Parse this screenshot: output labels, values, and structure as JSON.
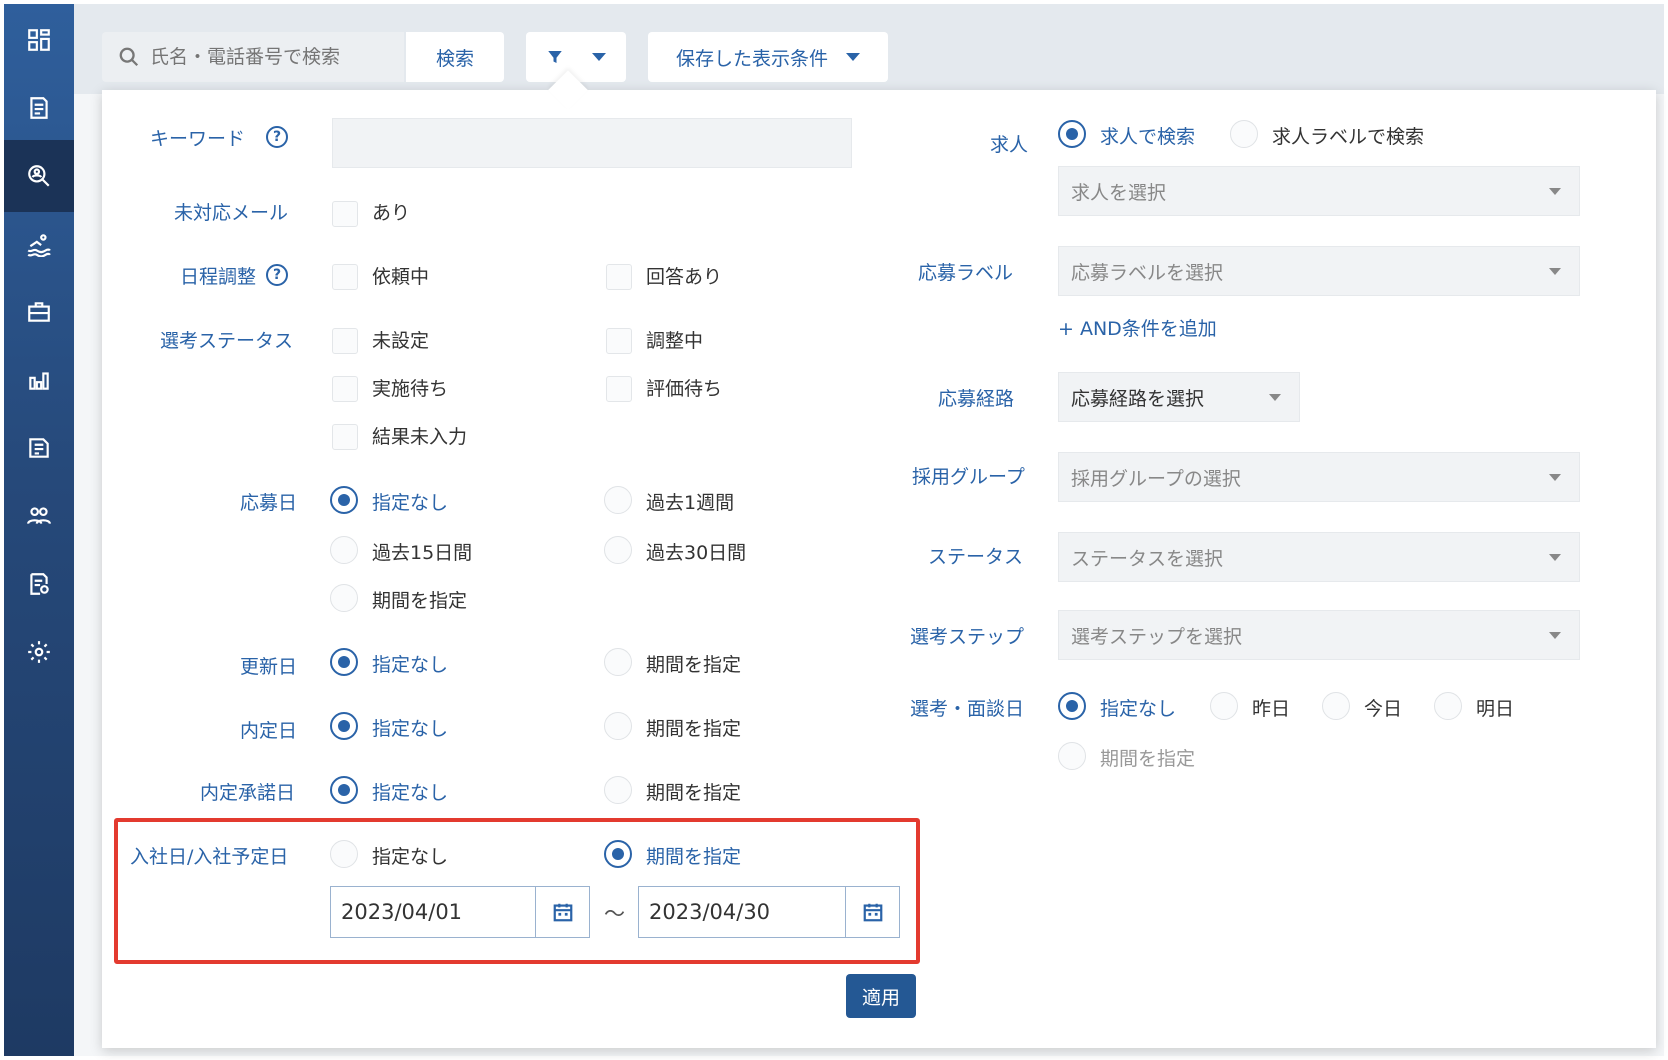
{
  "topbar": {
    "search_placeholder": "氏名・電話番号で検索",
    "search_button": "検索",
    "saved_conditions": "保存した表示条件"
  },
  "sidebar": {
    "items": [
      {
        "icon": "dashboard-icon",
        "active": false
      },
      {
        "icon": "document-list-icon",
        "active": false
      },
      {
        "icon": "search-person-icon",
        "active": true
      },
      {
        "icon": "swimmer-icon",
        "active": false
      },
      {
        "icon": "briefcase-icon",
        "active": false
      },
      {
        "icon": "bar-chart-icon",
        "active": false
      },
      {
        "icon": "book-icon",
        "active": false
      },
      {
        "icon": "users-icon",
        "active": false
      },
      {
        "icon": "document-settings-icon",
        "active": false
      },
      {
        "icon": "gear-icon",
        "active": false
      }
    ]
  },
  "filters_left": {
    "keyword": {
      "label": "キーワード",
      "value": ""
    },
    "unanswered_mail": {
      "label": "未対応メール",
      "options": [
        "あり"
      ]
    },
    "schedule": {
      "label": "日程調整",
      "options": [
        "依頼中",
        "回答あり"
      ]
    },
    "selection_status": {
      "label": "選考ステータス",
      "options": [
        "未設定",
        "調整中",
        "実施待ち",
        "評価待ち",
        "結果未入力"
      ]
    },
    "applied_date": {
      "label": "応募日",
      "options": [
        "指定なし",
        "過去1週間",
        "過去15日間",
        "過去30日間",
        "期間を指定"
      ],
      "selected": "指定なし"
    },
    "updated_date": {
      "label": "更新日",
      "options": [
        "指定なし",
        "期間を指定"
      ],
      "selected": "指定なし"
    },
    "offer_date": {
      "label": "内定日",
      "options": [
        "指定なし",
        "期間を指定"
      ],
      "selected": "指定なし"
    },
    "offer_accept_date": {
      "label": "内定承諾日",
      "options": [
        "指定なし",
        "期間を指定"
      ],
      "selected": "指定なし"
    },
    "join_date": {
      "label": "入社日/入社予定日",
      "options": [
        "指定なし",
        "期間を指定"
      ],
      "selected": "期間を指定",
      "from": "2023/04/01",
      "to": "2023/04/30",
      "separator": "〜"
    }
  },
  "filters_right": {
    "job": {
      "label": "求人",
      "options": [
        "求人で検索",
        "求人ラベルで検索"
      ],
      "selected": "求人で検索",
      "select_placeholder": "求人を選択"
    },
    "application_label": {
      "label": "応募ラベル",
      "select_placeholder": "応募ラベルを選択",
      "add_condition": "+ AND条件を追加"
    },
    "application_route": {
      "label": "応募経路",
      "select_value": "応募経路を選択"
    },
    "hiring_group": {
      "label": "採用グループ",
      "select_placeholder": "採用グループの選択"
    },
    "status": {
      "label": "ステータス",
      "select_placeholder": "ステータスを選択"
    },
    "selection_step": {
      "label": "選考ステップ",
      "select_placeholder": "選考ステップを選択"
    },
    "interview_date": {
      "label": "選考・面談日",
      "options": [
        "指定なし",
        "昨日",
        "今日",
        "明日",
        "期間を指定"
      ],
      "selected": "指定なし"
    }
  },
  "apply_button": "適用",
  "colors": {
    "accent": "#2a63a8",
    "highlight": "#e33a2f",
    "sidebar": "#26497a",
    "apply": "#245894"
  }
}
